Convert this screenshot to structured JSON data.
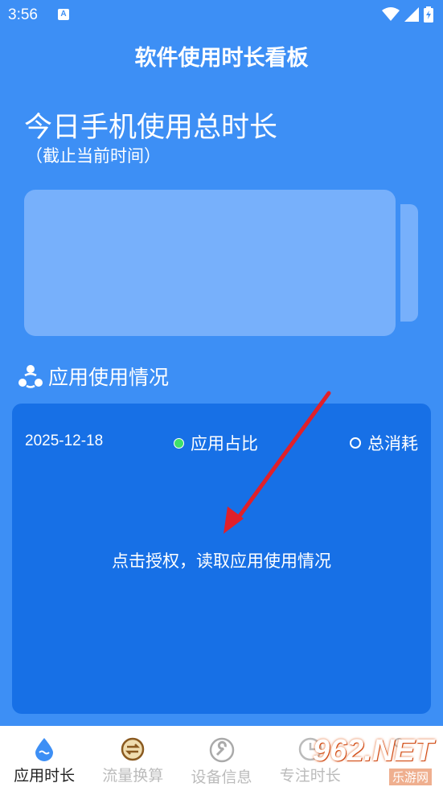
{
  "status_bar": {
    "time": "3:56",
    "notification_badge": "A"
  },
  "header": {
    "title": "软件使用时长看板"
  },
  "today": {
    "title": "今日手机使用总时长",
    "subtitle": "（截止当前时间）"
  },
  "usage_section": {
    "title": "应用使用情况",
    "icon": "app-usage-icon",
    "card": {
      "date": "2025-12-18",
      "legend_app_ratio": "应用占比",
      "legend_total": "总消耗",
      "legend_app_color": "#3ee06a",
      "prompt": "点击授权，读取应用使用情况"
    }
  },
  "bottom_nav": {
    "items": [
      {
        "label": "应用时长",
        "icon": "water-drop-icon",
        "active": true
      },
      {
        "label": "流量换算",
        "icon": "exchange-icon",
        "active": false
      },
      {
        "label": "设备信息",
        "icon": "wrench-icon",
        "active": false
      },
      {
        "label": "专注时长",
        "icon": "clock-icon",
        "active": false
      },
      {
        "label": "",
        "icon": "profile-icon",
        "active": false
      }
    ]
  },
  "watermark": {
    "text": "962.NET",
    "sub": "乐游网"
  },
  "colors": {
    "background": "#3d8ff5",
    "battery": "#77b0fb",
    "card": "#1770e6",
    "arrow": "#e0202a",
    "nav_active_icon": "#3d8ff5"
  }
}
